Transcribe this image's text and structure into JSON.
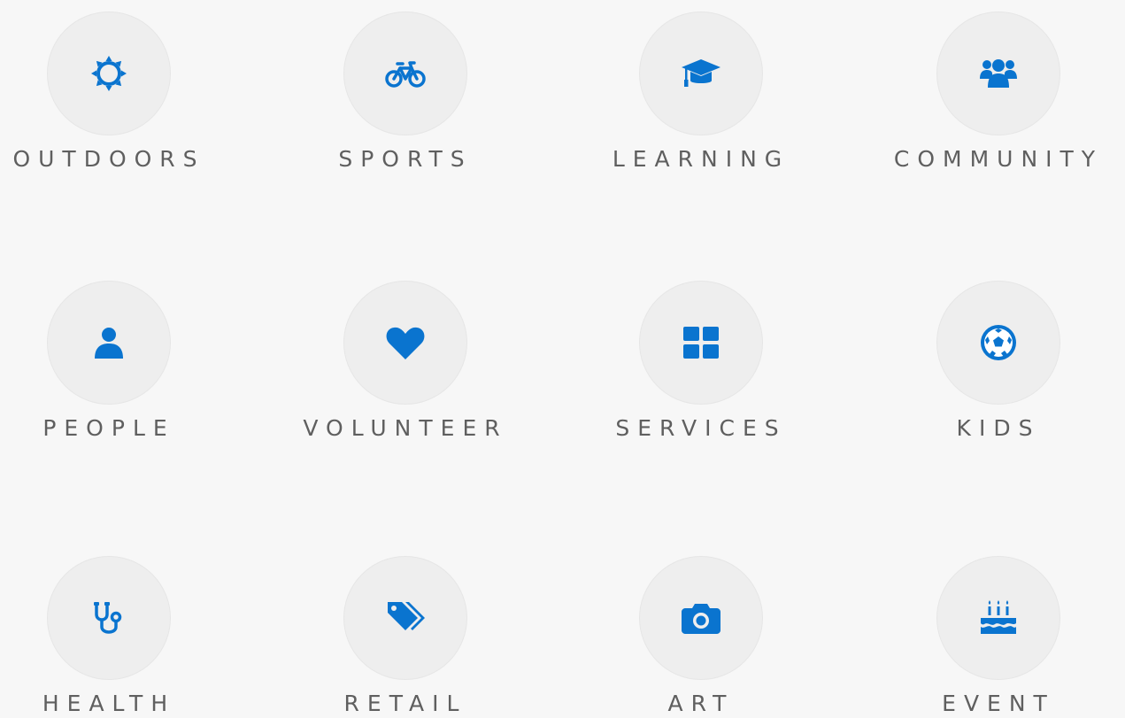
{
  "accent_color": "#0a74cf",
  "label_color": "#5f5f5f",
  "categories": [
    {
      "label": "OUTDOORS",
      "icon": "sun-icon"
    },
    {
      "label": "SPORTS",
      "icon": "bicycle-icon"
    },
    {
      "label": "LEARNING",
      "icon": "graduation-cap-icon"
    },
    {
      "label": "COMMUNITY",
      "icon": "users-icon"
    },
    {
      "label": "PEOPLE",
      "icon": "user-icon"
    },
    {
      "label": "VOLUNTEER",
      "icon": "heart-icon"
    },
    {
      "label": "SERVICES",
      "icon": "grid-icon"
    },
    {
      "label": "KIDS",
      "icon": "soccer-ball-icon"
    },
    {
      "label": "HEALTH",
      "icon": "stethoscope-icon"
    },
    {
      "label": "RETAIL",
      "icon": "tags-icon"
    },
    {
      "label": "ART",
      "icon": "camera-icon"
    },
    {
      "label": "EVENT",
      "icon": "birthday-cake-icon"
    }
  ]
}
